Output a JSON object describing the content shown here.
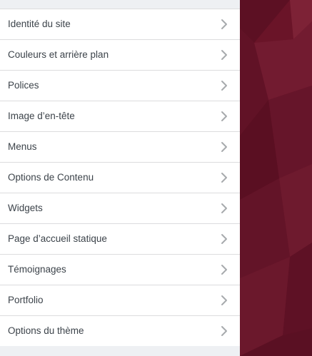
{
  "customizer": {
    "sections": [
      {
        "label": "Identité du site",
        "icon": "chevron-right-icon"
      },
      {
        "label": "Couleurs et arrière plan",
        "icon": "chevron-right-icon"
      },
      {
        "label": "Polices",
        "icon": "chevron-right-icon"
      },
      {
        "label": "Image d’en-tête",
        "icon": "chevron-right-icon"
      },
      {
        "label": "Menus",
        "icon": "chevron-right-icon"
      },
      {
        "label": "Options de Contenu",
        "icon": "chevron-right-icon"
      },
      {
        "label": "Widgets",
        "icon": "chevron-right-icon"
      },
      {
        "label": "Page d’accueil statique",
        "icon": "chevron-right-icon"
      },
      {
        "label": "Témoignages",
        "icon": "chevron-right-icon"
      },
      {
        "label": "Portfolio",
        "icon": "chevron-right-icon"
      },
      {
        "label": "Options du thème",
        "icon": "chevron-right-icon"
      }
    ]
  },
  "colors": {
    "panel_background": "#eef0f3",
    "item_background": "#ffffff",
    "item_text": "#3c434a",
    "chevron": "#a7aaad",
    "divider": "#dcdcde",
    "preview_dark": "#5c1023",
    "preview_mid": "#6e1a2e",
    "preview_light": "#7d2236"
  }
}
